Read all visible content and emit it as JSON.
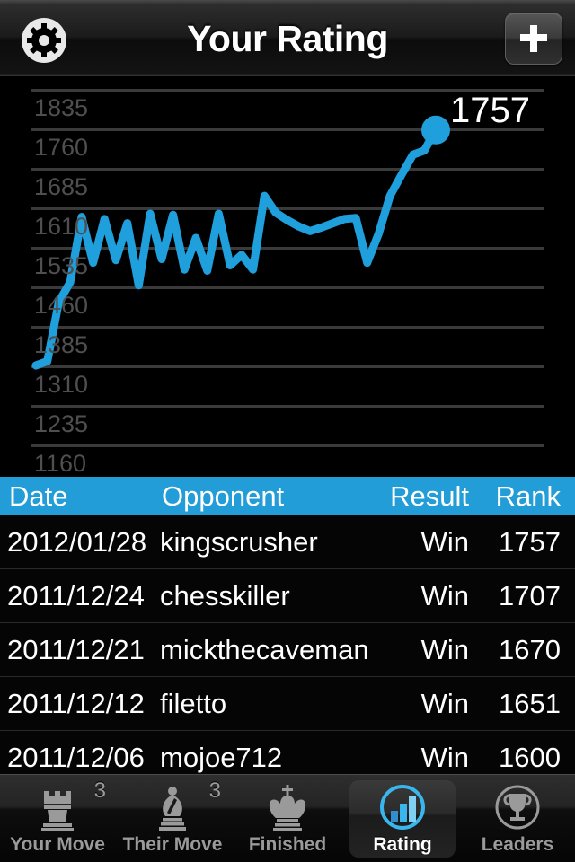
{
  "navbar": {
    "title": "Your Rating",
    "settings_icon": "gear-icon",
    "add_label": "+",
    "add_icon": "plus-icon"
  },
  "chart_data": {
    "type": "line",
    "title": "Your Rating",
    "xlabel": "",
    "ylabel": "Rating",
    "grid": true,
    "legend": "none",
    "line_color": "#1f9fdb",
    "point_color": "#1f9fdb",
    "ylim": [
      1160,
      1872
    ],
    "yticks": [
      1835,
      1760,
      1685,
      1610,
      1535,
      1460,
      1385,
      1310,
      1235,
      1160
    ],
    "end_point_label": "1757",
    "end_point_value": 1757,
    "values": [
      1310,
      1318,
      1430,
      1468,
      1592,
      1505,
      1588,
      1510,
      1580,
      1462,
      1598,
      1512,
      1596,
      1492,
      1552,
      1490,
      1598,
      1500,
      1520,
      1492,
      1632,
      1600,
      1586,
      1574,
      1565,
      1572,
      1580,
      1588,
      1590,
      1505,
      1560,
      1632,
      1672,
      1710,
      1718,
      1757
    ]
  },
  "table": {
    "columns": [
      "Date",
      "Opponent",
      "Result",
      "Rank"
    ],
    "header_color": "#229dd8",
    "rows": [
      {
        "date": "2012/01/28",
        "opponent": "kingscrusher",
        "result": "Win",
        "rank": "1757"
      },
      {
        "date": "2011/12/24",
        "opponent": "chesskiller",
        "result": "Win",
        "rank": "1707"
      },
      {
        "date": "2011/12/21",
        "opponent": "mickthecaveman",
        "result": "Win",
        "rank": "1670"
      },
      {
        "date": "2011/12/12",
        "opponent": "filetto",
        "result": "Win",
        "rank": "1651"
      },
      {
        "date": "2011/12/06",
        "opponent": "mojoe712",
        "result": "Win",
        "rank": "1600"
      }
    ]
  },
  "tabbar": {
    "items": [
      {
        "label": "Your Move",
        "icon": "chess-rook-icon",
        "badge": "3",
        "selected": false
      },
      {
        "label": "Their Move",
        "icon": "chess-bishop-icon",
        "badge": "3",
        "selected": false
      },
      {
        "label": "Finished",
        "icon": "chess-king-icon",
        "badge": "",
        "selected": false
      },
      {
        "label": "Rating",
        "icon": "bar-chart-icon",
        "badge": "",
        "selected": true
      },
      {
        "label": "Leaders",
        "icon": "trophy-icon",
        "badge": "",
        "selected": false
      }
    ]
  }
}
